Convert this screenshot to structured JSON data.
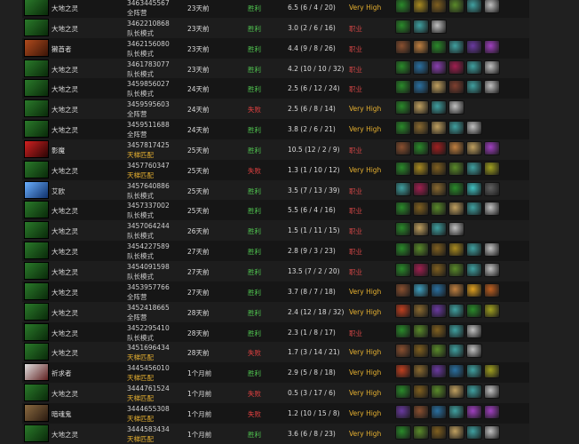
{
  "columns": [
    "hero",
    "match",
    "time",
    "result",
    "kda",
    "skill",
    "items"
  ],
  "heroes": {
    "earth": {
      "name": "大地之灵",
      "colors": [
        "#2a7a2a",
        "#0a2a0a"
      ]
    },
    "tusk": {
      "name": "獭酋者",
      "colors": [
        "#b04a1c",
        "#3a1508"
      ]
    },
    "shadow": {
      "name": "影魔",
      "colors": [
        "#d02020",
        "#2a0505"
      ]
    },
    "invoker": {
      "name": "艾欧",
      "colors": [
        "#6ab0ff",
        "#10306a"
      ]
    },
    "pray": {
      "name": "祈求者",
      "colors": [
        "#e0e0e0",
        "#602020"
      ]
    },
    "ghost": {
      "name": "暗魂鬼",
      "colors": [
        "#8a6a40",
        "#2a1a10"
      ]
    }
  },
  "rows": [
    {
      "hero": "earth",
      "match_id": "3463445567",
      "mode": "全阵营",
      "mode_type": "normal",
      "time": "23天前",
      "result": "胜利",
      "result_type": "win",
      "kda": "6.5 (6 / 4 / 20)",
      "skill": "Very High",
      "skill_type": "vh",
      "items": [
        "#2a8a2a",
        "#a88a20",
        "#806020",
        "#5a8a2a",
        "#40a0a0",
        "#c0c0c0"
      ]
    },
    {
      "hero": "earth",
      "match_id": "3462210868",
      "mode": "队长模式",
      "mode_type": "normal",
      "time": "23天前",
      "result": "胜利",
      "result_type": "win",
      "kda": "3.0 (2 / 6 / 16)",
      "skill": "职业",
      "skill_type": "pro",
      "items": [
        "#2a8a2a",
        "#40a0a0",
        "#c0c0c0"
      ]
    },
    {
      "hero": "tusk",
      "match_id": "3462156080",
      "mode": "队长模式",
      "mode_type": "normal",
      "time": "23天前",
      "result": "胜利",
      "result_type": "win",
      "kda": "4.4 (9 / 8 / 26)",
      "skill": "职业",
      "skill_type": "pro",
      "items": [
        "#8a5030",
        "#c08040",
        "#2a8a2a",
        "#40a0a0",
        "#6a3aa0",
        "#a040c0"
      ]
    },
    {
      "hero": "earth",
      "match_id": "3461783077",
      "mode": "队长模式",
      "mode_type": "normal",
      "time": "23天前",
      "result": "胜利",
      "result_type": "win",
      "kda": "4.2 (10 / 10 / 32)",
      "skill": "职业",
      "skill_type": "pro",
      "items": [
        "#2a8a2a",
        "#2a70a0",
        "#8a40b0",
        "#a02050",
        "#40a0a0",
        "#c0c0c0"
      ]
    },
    {
      "hero": "earth",
      "match_id": "3459856027",
      "mode": "队长模式",
      "mode_type": "normal",
      "time": "24天前",
      "result": "胜利",
      "result_type": "win",
      "kda": "2.5 (6 / 12 / 24)",
      "skill": "职业",
      "skill_type": "pro",
      "items": [
        "#2a8a2a",
        "#2a70a0",
        "#c0a060",
        "#804030",
        "#40a0a0",
        "#c0c0c0"
      ]
    },
    {
      "hero": "earth",
      "match_id": "3459595603",
      "mode": "全阵营",
      "mode_type": "normal",
      "time": "24天前",
      "result": "失败",
      "result_type": "loss",
      "kda": "2.5 (6 / 8 / 14)",
      "skill": "Very High",
      "skill_type": "vh",
      "items": [
        "#2a8a2a",
        "#c0a060",
        "#40a0a0",
        "#c0c0c0"
      ]
    },
    {
      "hero": "earth",
      "match_id": "3459511688",
      "mode": "全阵营",
      "mode_type": "normal",
      "time": "24天前",
      "result": "胜利",
      "result_type": "win",
      "kda": "3.8 (2 / 6 / 21)",
      "skill": "Very High",
      "skill_type": "vh",
      "items": [
        "#2a8a2a",
        "#8a6a30",
        "#c0a060",
        "#40a0a0",
        "#c0c0c0"
      ]
    },
    {
      "hero": "shadow",
      "match_id": "3457817425",
      "mode": "天梯匹配",
      "mode_type": "ranked",
      "time": "25天前",
      "result": "胜利",
      "result_type": "win",
      "kda": "10.5 (12 / 2 / 9)",
      "skill": "职业",
      "skill_type": "pro",
      "items": [
        "#8a5030",
        "#2a8a2a",
        "#a02020",
        "#c08040",
        "#c0a060",
        "#a040c0"
      ]
    },
    {
      "hero": "earth",
      "match_id": "3457760347",
      "mode": "天梯匹配",
      "mode_type": "ranked",
      "time": "25天前",
      "result": "失败",
      "result_type": "loss",
      "kda": "1.3 (1 / 10 / 12)",
      "skill": "Very High",
      "skill_type": "vh",
      "items": [
        "#2a8a2a",
        "#a88a20",
        "#806020",
        "#5a8a2a",
        "#40a0a0",
        "#a0a020"
      ]
    },
    {
      "hero": "invoker",
      "match_id": "3457640886",
      "mode": "队长模式",
      "mode_type": "normal",
      "time": "25天前",
      "result": "胜利",
      "result_type": "win",
      "kda": "3.5 (7 / 13 / 39)",
      "skill": "职业",
      "skill_type": "pro",
      "items": [
        "#40a0a0",
        "#a02050",
        "#8a6a30",
        "#2a8a2a",
        "#40c0c0",
        "#606060"
      ]
    },
    {
      "hero": "earth",
      "match_id": "3457337002",
      "mode": "队长模式",
      "mode_type": "normal",
      "time": "25天前",
      "result": "胜利",
      "result_type": "win",
      "kda": "5.5 (6 / 4 / 16)",
      "skill": "职业",
      "skill_type": "pro",
      "items": [
        "#2a8a2a",
        "#806020",
        "#5a8a2a",
        "#c0a060",
        "#40a0a0",
        "#c0c0c0"
      ]
    },
    {
      "hero": "earth",
      "match_id": "3457064244",
      "mode": "队长模式",
      "mode_type": "normal",
      "time": "26天前",
      "result": "胜利",
      "result_type": "win",
      "kda": "1.5 (1 / 11 / 15)",
      "skill": "职业",
      "skill_type": "pro",
      "items": [
        "#2a8a2a",
        "#c0a060",
        "#40a0a0",
        "#c0c0c0"
      ]
    },
    {
      "hero": "earth",
      "match_id": "3454227589",
      "mode": "队长模式",
      "mode_type": "normal",
      "time": "27天前",
      "result": "胜利",
      "result_type": "win",
      "kda": "2.8 (9 / 3 / 23)",
      "skill": "职业",
      "skill_type": "pro",
      "items": [
        "#2a8a2a",
        "#5a8a2a",
        "#806020",
        "#a88a20",
        "#40a0a0",
        "#c0c0c0"
      ]
    },
    {
      "hero": "earth",
      "match_id": "3454091598",
      "mode": "队长模式",
      "mode_type": "normal",
      "time": "27天前",
      "result": "胜利",
      "result_type": "win",
      "kda": "13.5 (7 / 2 / 20)",
      "skill": "职业",
      "skill_type": "pro",
      "items": [
        "#2a8a2a",
        "#a02050",
        "#806020",
        "#5a8a2a",
        "#40a0a0",
        "#c0c0c0"
      ]
    },
    {
      "hero": "earth",
      "match_id": "3453957766",
      "mode": "全阵营",
      "mode_type": "normal",
      "time": "27天前",
      "result": "胜利",
      "result_type": "win",
      "kda": "3.7 (8 / 7 / 18)",
      "skill": "Very High",
      "skill_type": "vh",
      "items": [
        "#8a5030",
        "#40a0c0",
        "#2a70a0",
        "#c08040",
        "#e0a020",
        "#c06020"
      ]
    },
    {
      "hero": "earth",
      "match_id": "3452418665",
      "mode": "全阵营",
      "mode_type": "normal",
      "time": "28天前",
      "result": "胜利",
      "result_type": "win",
      "kda": "2.4 (12 / 18 / 32)",
      "skill": "Very High",
      "skill_type": "vh",
      "items": [
        "#c04020",
        "#8a6a30",
        "#6a3aa0",
        "#40a0a0",
        "#2a8a2a",
        "#a0a020"
      ]
    },
    {
      "hero": "earth",
      "match_id": "3452295410",
      "mode": "队长模式",
      "mode_type": "normal",
      "time": "28天前",
      "result": "胜利",
      "result_type": "win",
      "kda": "2.3 (1 / 8 / 17)",
      "skill": "职业",
      "skill_type": "pro",
      "items": [
        "#2a8a2a",
        "#5a8a2a",
        "#806020",
        "#40a0a0",
        "#c0c0c0"
      ]
    },
    {
      "hero": "earth",
      "match_id": "3451696434",
      "mode": "天梯匹配",
      "mode_type": "ranked",
      "time": "28天前",
      "result": "失败",
      "result_type": "loss",
      "kda": "1.7 (3 / 14 / 21)",
      "skill": "Very High",
      "skill_type": "vh",
      "items": [
        "#8a5030",
        "#806020",
        "#5a8a2a",
        "#40a0a0",
        "#c0c0c0"
      ]
    },
    {
      "hero": "pray",
      "match_id": "3445456010",
      "mode": "天梯匹配",
      "mode_type": "ranked",
      "time": "1个月前",
      "result": "胜利",
      "result_type": "win",
      "kda": "2.9 (5 / 8 / 18)",
      "skill": "Very High",
      "skill_type": "vh",
      "items": [
        "#c04020",
        "#8a6a30",
        "#6a3aa0",
        "#2a70a0",
        "#40a0a0",
        "#a0a020"
      ]
    },
    {
      "hero": "earth",
      "match_id": "3444761524",
      "mode": "天梯匹配",
      "mode_type": "ranked",
      "time": "1个月前",
      "result": "失败",
      "result_type": "loss",
      "kda": "0.5 (3 / 17 / 6)",
      "skill": "Very High",
      "skill_type": "vh",
      "items": [
        "#2a8a2a",
        "#806020",
        "#5a8a2a",
        "#c0a060",
        "#40a0a0",
        "#c0c0c0"
      ]
    },
    {
      "hero": "ghost",
      "match_id": "3444655308",
      "mode": "天梯匹配",
      "mode_type": "ranked",
      "time": "1个月前",
      "result": "失败",
      "result_type": "loss",
      "kda": "1.2 (10 / 15 / 8)",
      "skill": "Very High",
      "skill_type": "vh",
      "items": [
        "#6a3aa0",
        "#8a5030",
        "#2a70a0",
        "#40a0a0",
        "#a040c0",
        "#a040c0"
      ]
    },
    {
      "hero": "earth",
      "match_id": "3444583434",
      "mode": "天梯匹配",
      "mode_type": "ranked",
      "time": "1个月前",
      "result": "胜利",
      "result_type": "win",
      "kda": "3.6 (6 / 8 / 23)",
      "skill": "Very High",
      "skill_type": "vh",
      "items": [
        "#2a8a2a",
        "#5a8a2a",
        "#806020",
        "#c0a060",
        "#40a0a0",
        "#c0c0c0"
      ]
    }
  ]
}
